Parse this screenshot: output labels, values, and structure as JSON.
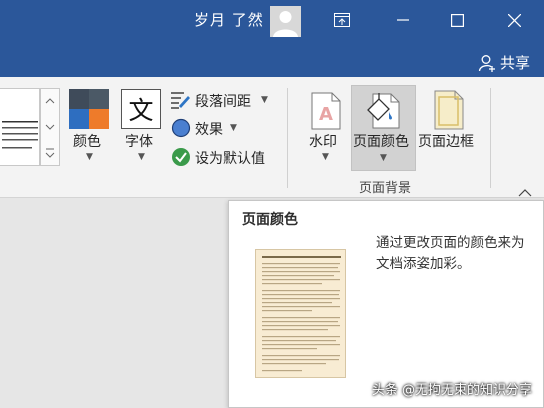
{
  "titlebar": {
    "user_name": "岁月 了然",
    "share_label": "共享"
  },
  "ribbon": {
    "colors_label": "颜色",
    "fonts_label": "字体",
    "fonts_glyph": "文",
    "paragraph_spacing_label": "段落间距",
    "effects_label": "效果",
    "set_default_label": "设为默认值",
    "watermark_label": "水印",
    "page_color_label": "页面颜色",
    "page_borders_label": "页面边框",
    "group_label": "页面背景"
  },
  "tooltip": {
    "title": "页面颜色",
    "description": "通过更改页面的颜色来为文档添姿加彩。"
  },
  "overlay": {
    "watermark_text": "头条 @无拘无束的知识分享"
  },
  "colors": {
    "titlebar": "#2b579a",
    "page_color_thumb": "#f8ecd3"
  }
}
